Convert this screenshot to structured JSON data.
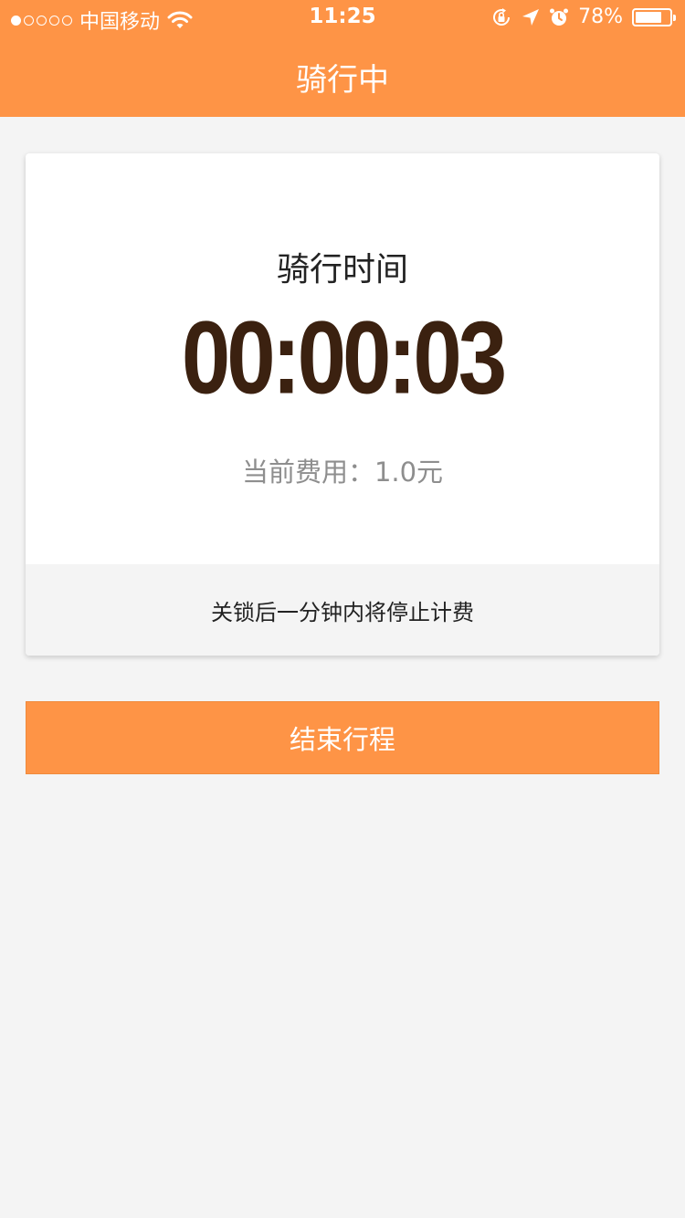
{
  "status_bar": {
    "carrier": "中国移动",
    "time": "11:25",
    "battery_percent": "78%",
    "battery_level": 0.78,
    "icons": [
      "signal-dots-icon",
      "wifi-icon",
      "rotation-lock-icon",
      "location-arrow-icon",
      "alarm-icon",
      "battery-icon"
    ]
  },
  "nav": {
    "title": "骑行中"
  },
  "ride_card": {
    "label": "骑行时间",
    "elapsed_time": "00:00:03",
    "fee_text": "当前费用：1.0元",
    "notice": "关锁后一分钟内将停止计费"
  },
  "actions": {
    "end_trip_label": "结束行程"
  },
  "colors": {
    "accent": "#fe9446",
    "timer": "#3b2110",
    "background": "#f4f4f4"
  }
}
